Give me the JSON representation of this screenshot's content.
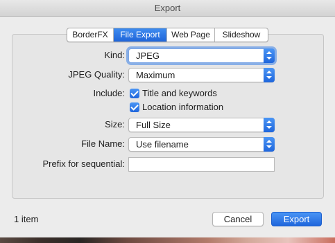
{
  "window": {
    "title": "Export"
  },
  "tabs": [
    {
      "label": "BorderFX",
      "active": false
    },
    {
      "label": "File Export",
      "active": true
    },
    {
      "label": "Web Page",
      "active": false
    },
    {
      "label": "Slideshow",
      "active": false
    }
  ],
  "form": {
    "kind": {
      "label": "Kind:",
      "value": "JPEG"
    },
    "jpeg_quality": {
      "label": "JPEG Quality:",
      "value": "Maximum"
    },
    "include": {
      "label": "Include:",
      "title_keywords": {
        "label": "Title and keywords",
        "checked": true
      },
      "location": {
        "label": "Location information",
        "checked": true
      }
    },
    "size": {
      "label": "Size:",
      "value": "Full Size"
    },
    "file_name": {
      "label": "File Name:",
      "value": "Use filename"
    },
    "prefix": {
      "label": "Prefix for sequential:",
      "value": ""
    }
  },
  "footer": {
    "item_count": "1 item",
    "cancel_label": "Cancel",
    "export_label": "Export"
  },
  "colors": {
    "accent": "#1f66dc",
    "focus_ring": "#5892e6"
  },
  "icons": {
    "popup_stepper": "up-down-chevron-icon",
    "checkbox": "checkmark-icon"
  }
}
